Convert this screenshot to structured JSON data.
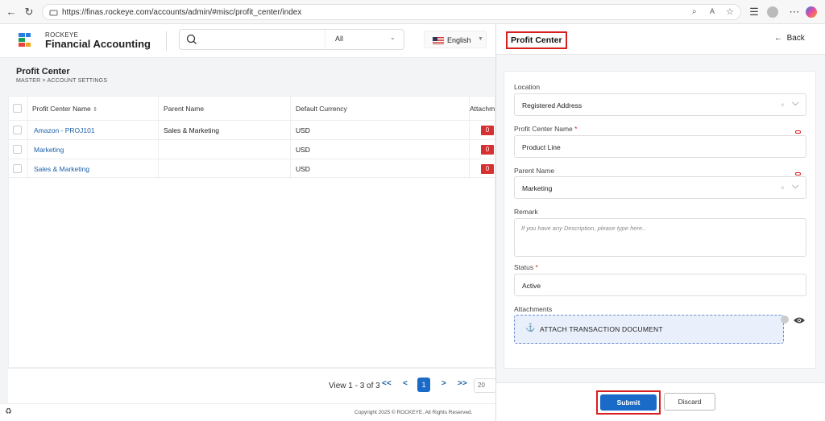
{
  "browser": {
    "url": "https://finas.rockeye.com/accounts/admin/#misc/profit_center/index"
  },
  "brand": {
    "top": "ROCKEYE",
    "main": "Financial Accounting"
  },
  "search": {
    "filter": "All"
  },
  "language": {
    "label": "English"
  },
  "page": {
    "title": "Profit Center",
    "breadcrumb": "MASTER  >  ACCOUNT SETTINGS"
  },
  "table": {
    "headers": [
      "Profit Center Name",
      "Parent Name",
      "Default Currency",
      "Attachm"
    ],
    "sort_icon": "⇕",
    "rows": [
      {
        "name": "Amazon - PROJ101",
        "parent": "Sales & Marketing",
        "currency": "USD",
        "attach": "0"
      },
      {
        "name": "Marketing",
        "parent": "",
        "currency": "USD",
        "attach": "0"
      },
      {
        "name": "Sales & Marketing",
        "parent": "",
        "currency": "USD",
        "attach": "0"
      }
    ]
  },
  "pager": {
    "info": "View 1 - 3 of 3",
    "first": "<<",
    "prev": "<",
    "current": "1",
    "next": ">",
    "last": ">>",
    "size": "20"
  },
  "footer": {
    "copyright": "Copyright 2025 © ROCKEYE. All Rights Reserved."
  },
  "panel": {
    "title": "Profit Center",
    "back": "Back",
    "location_label": "Location",
    "location_value": "Registered Address",
    "name_label": "Profit Center Name",
    "name_value": "Product Line",
    "parent_label": "Parent Name",
    "parent_value": "Marketing",
    "remark_label": "Remark",
    "remark_placeholder": "If you have any Description, please type here..",
    "status_label": "Status",
    "status_value": "Active",
    "attach_label": "Attachments",
    "attach_button": "ATTACH TRANSACTION DOCUMENT",
    "required_mark": "*",
    "clear_mark": "×",
    "submit": "Submit",
    "discard": "Discard"
  },
  "colors": {
    "accent": "#1a6bc7",
    "danger": "#d63030"
  }
}
